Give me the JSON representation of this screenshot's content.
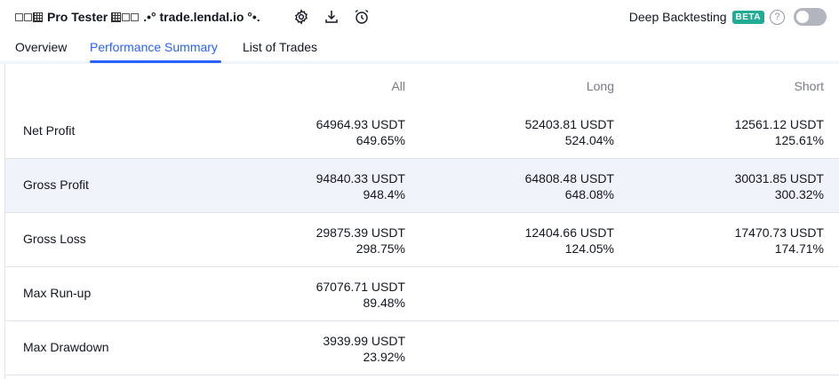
{
  "header": {
    "title": "Pro Tester",
    "site": ".•° trade.lendal.io °•.",
    "icons": [
      "gear-icon",
      "download-icon",
      "alarm-clock-icon"
    ],
    "deep_backtesting_label": "Deep Backtesting",
    "beta_badge": "BETA",
    "help_glyph": "?",
    "toggle_state": "off"
  },
  "tabs": [
    {
      "label": "Overview",
      "active": false
    },
    {
      "label": "Performance Summary",
      "active": true
    },
    {
      "label": "List of Trades",
      "active": false
    }
  ],
  "colors": {
    "accent": "#2962ff",
    "beta": "#22ab94",
    "row_highlight": "#f0f3fa",
    "muted_text": "#787b86"
  },
  "table": {
    "columns": [
      "All",
      "Long",
      "Short"
    ],
    "rows": [
      {
        "label": "Net Profit",
        "all": {
          "value": "64964.93 USDT",
          "pct": "649.65%"
        },
        "long": {
          "value": "52403.81 USDT",
          "pct": "524.04%"
        },
        "short": {
          "value": "12561.12 USDT",
          "pct": "125.61%"
        }
      },
      {
        "label": "Gross Profit",
        "all": {
          "value": "94840.33 USDT",
          "pct": "948.4%"
        },
        "long": {
          "value": "64808.48 USDT",
          "pct": "648.08%"
        },
        "short": {
          "value": "30031.85 USDT",
          "pct": "300.32%"
        }
      },
      {
        "label": "Gross Loss",
        "all": {
          "value": "29875.39 USDT",
          "pct": "298.75%"
        },
        "long": {
          "value": "12404.66 USDT",
          "pct": "124.05%"
        },
        "short": {
          "value": "17470.73 USDT",
          "pct": "174.71%"
        }
      },
      {
        "label": "Max Run-up",
        "all": {
          "value": "67076.71 USDT",
          "pct": "89.48%"
        },
        "long": {
          "value": "",
          "pct": ""
        },
        "short": {
          "value": "",
          "pct": ""
        }
      },
      {
        "label": "Max Drawdown",
        "all": {
          "value": "3939.99 USDT",
          "pct": "23.92%"
        },
        "long": {
          "value": "",
          "pct": ""
        },
        "short": {
          "value": "",
          "pct": ""
        }
      }
    ]
  }
}
